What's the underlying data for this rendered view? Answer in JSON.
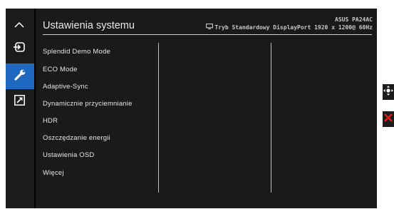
{
  "title": "Ustawienia systemu",
  "info": {
    "model": "ASUS PA24AC",
    "mode": "Tryb Standardowy",
    "input": "DisplayPort",
    "resolution": "1920 x 1200@",
    "refresh": "60Hz"
  },
  "sidebar": {
    "items": [
      {
        "icon": "chevron-up-icon"
      },
      {
        "icon": "input-icon"
      },
      {
        "icon": "wrench-icon",
        "active": true
      },
      {
        "icon": "shortcut-icon"
      }
    ]
  },
  "menu": {
    "items": [
      {
        "label": "Splendid Demo Mode"
      },
      {
        "label": "ECO Mode"
      },
      {
        "label": "Adaptive-Sync"
      },
      {
        "label": "Dynamicznie przyciemnianie"
      },
      {
        "label": "HDR"
      },
      {
        "label": "Oszczędzanie energii"
      },
      {
        "label": "Ustawienia OSD"
      },
      {
        "label": "Więcej"
      }
    ]
  },
  "side_buttons": [
    "move-joystick-icon",
    "close-icon"
  ],
  "colors": {
    "accent": "#1f68c1",
    "close": "#e0201b",
    "background": "#000000"
  }
}
